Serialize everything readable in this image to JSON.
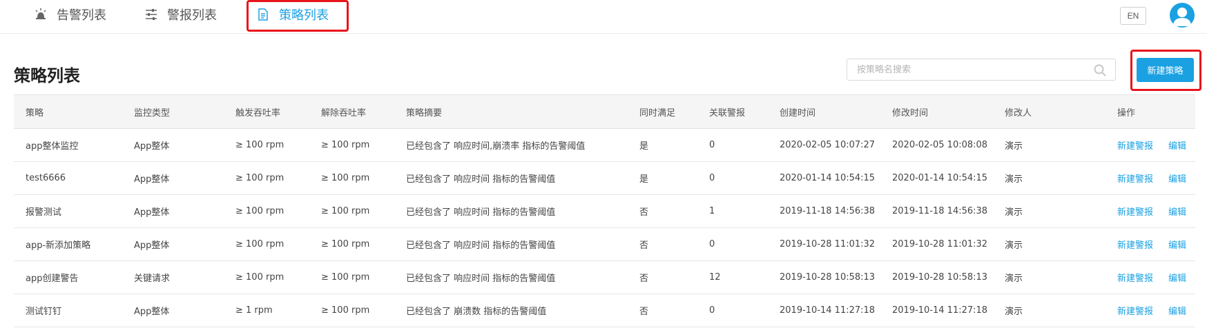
{
  "nav": {
    "tabs": [
      {
        "label": "告警列表",
        "icon": "alarm-light-icon"
      },
      {
        "label": "警报列表",
        "icon": "sliders-icon"
      },
      {
        "label": "策略列表",
        "icon": "document-icon",
        "active": true
      }
    ],
    "lang_button": "EN",
    "avatar_icon": "user-avatar-icon"
  },
  "page": {
    "title": "策略列表",
    "search_placeholder": "按策略名搜索",
    "new_button": "新建策略"
  },
  "colors": {
    "accent": "#1ba1e2",
    "highlight": "#e8131a",
    "header_bg": "#f5f5f5"
  },
  "table": {
    "columns": [
      "策略",
      "监控类型",
      "触发吞吐率",
      "解除吞吐率",
      "策略摘要",
      "同时满足",
      "关联警报",
      "创建时间",
      "修改时间",
      "修改人",
      "操作"
    ],
    "rows": [
      {
        "name": "app整体监控",
        "type": "App整体",
        "trigger": "≥ 100 rpm",
        "release": "≥ 100 rpm",
        "summary": "已经包含了 响应时间,崩溃率 指标的告警阈值",
        "both": "是",
        "alarms": "0",
        "created": "2020-02-05 10:07:27",
        "modified": "2020-02-05 10:08:08",
        "modifier": "演示",
        "op_new": "新建警报",
        "op_edit": "编辑"
      },
      {
        "name": "test6666",
        "type": "App整体",
        "trigger": "≥ 100 rpm",
        "release": "≥ 100 rpm",
        "summary": "已经包含了 响应时间 指标的告警阈值",
        "both": "是",
        "alarms": "0",
        "created": "2020-01-14 10:54:15",
        "modified": "2020-01-14 10:54:15",
        "modifier": "演示",
        "op_new": "新建警报",
        "op_edit": "编辑"
      },
      {
        "name": "报警测试",
        "type": "App整体",
        "trigger": "≥ 100 rpm",
        "release": "≥ 100 rpm",
        "summary": "已经包含了 响应时间 指标的告警阈值",
        "both": "否",
        "alarms": "1",
        "created": "2019-11-18 14:56:38",
        "modified": "2019-11-18 14:56:38",
        "modifier": "演示",
        "op_new": "新建警报",
        "op_edit": "编辑"
      },
      {
        "name": "app-新添加策略",
        "type": "App整体",
        "trigger": "≥ 100 rpm",
        "release": "≥ 100 rpm",
        "summary": "已经包含了 响应时间 指标的告警阈值",
        "both": "否",
        "alarms": "0",
        "created": "2019-10-28 11:01:32",
        "modified": "2019-10-28 11:01:32",
        "modifier": "演示",
        "op_new": "新建警报",
        "op_edit": "编辑"
      },
      {
        "name": "app创建警告",
        "type": "关键请求",
        "trigger": "≥ 100 rpm",
        "release": "≥ 100 rpm",
        "summary": "已经包含了 响应时间 指标的告警阈值",
        "both": "否",
        "alarms": "12",
        "created": "2019-10-28 10:58:13",
        "modified": "2019-10-28 10:58:13",
        "modifier": "演示",
        "op_new": "新建警报",
        "op_edit": "编辑"
      },
      {
        "name": "测试钉钉",
        "type": "App整体",
        "trigger": "≥ 1 rpm",
        "release": "≥ 100 rpm",
        "summary": "已经包含了 崩溃数 指标的告警阈值",
        "both": "否",
        "alarms": "0",
        "created": "2019-10-14 11:27:18",
        "modified": "2019-10-14 11:27:18",
        "modifier": "演示",
        "op_new": "新建警报",
        "op_edit": "编辑"
      }
    ]
  }
}
